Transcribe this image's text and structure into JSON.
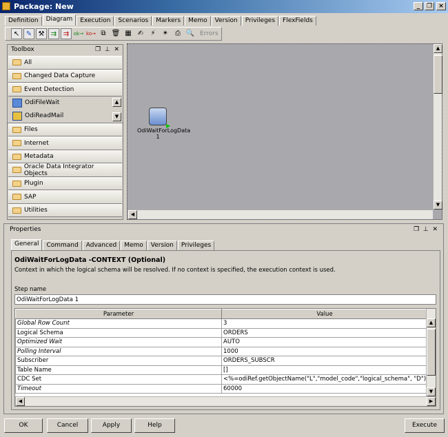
{
  "window": {
    "title": "Package: New"
  },
  "tabs": [
    "Definition",
    "Diagram",
    "Execution",
    "Scenarios",
    "Markers",
    "Memo",
    "Version",
    "Privileges",
    "FlexFields"
  ],
  "toolbar": {
    "errors_label": "Errors"
  },
  "toolbox": {
    "title": "Toolbox",
    "groups_top": [
      "All",
      "Changed Data Capture",
      "Event Detection"
    ],
    "event_items": [
      "OdiFileWait",
      "OdiReadMail"
    ],
    "groups_bottom": [
      "Files",
      "Internet",
      "Metadata",
      "Oracle Data Integrator Objects",
      "Plugin",
      "SAP",
      "Utilities"
    ]
  },
  "canvas": {
    "step_label": "OdiWaitForLogData",
    "step_number": "1"
  },
  "properties": {
    "title": "Properties",
    "tabs": [
      "General",
      "Command",
      "Advanced",
      "Memo",
      "Version",
      "Privileges"
    ],
    "heading": "OdiWaitForLogData -CONTEXT (Optional)",
    "description": "Context in which the logical schema will be resolved. If no context is specified, the execution context is used.",
    "step_name_label": "Step name",
    "step_name_value": "OdiWaitForLogData 1",
    "columns": [
      "Parameter",
      "Value"
    ],
    "rows": [
      {
        "param": "Global Row Count",
        "value": "3",
        "italic": true
      },
      {
        "param": "Logical Schema",
        "value": "ORDERS",
        "italic": false
      },
      {
        "param": "Optimized Wait",
        "value": "AUTO",
        "italic": true
      },
      {
        "param": "Polling Interval",
        "value": "1000",
        "italic": true
      },
      {
        "param": "Subscriber",
        "value": "ORDERS_SUBSCR",
        "italic": false
      },
      {
        "param": "Table Name",
        "value": "[]",
        "italic": false
      },
      {
        "param": "CDC Set",
        "value": "<%=odiRef.getObjectName(\"L\",\"model_code\",\"logical_schema\", \"D\")...",
        "italic": false
      },
      {
        "param": "Timeout",
        "value": "60000",
        "italic": true
      }
    ]
  },
  "buttons": {
    "ok": "OK",
    "cancel": "Cancel",
    "apply": "Apply",
    "help": "Help",
    "execute": "Execute"
  }
}
